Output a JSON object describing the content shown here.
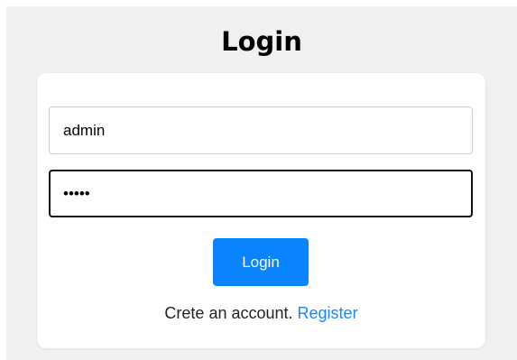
{
  "page": {
    "title": "Login"
  },
  "form": {
    "username": {
      "value": "admin",
      "placeholder": ""
    },
    "password": {
      "value": "•••••",
      "placeholder": ""
    },
    "submit_label": "Login"
  },
  "footer": {
    "prompt_text": "Crete an account.",
    "register_link": "Register"
  },
  "colors": {
    "accent": "#0a84ff",
    "link": "#1a85ff",
    "background": "#f0f0f0",
    "card": "#ffffff"
  }
}
